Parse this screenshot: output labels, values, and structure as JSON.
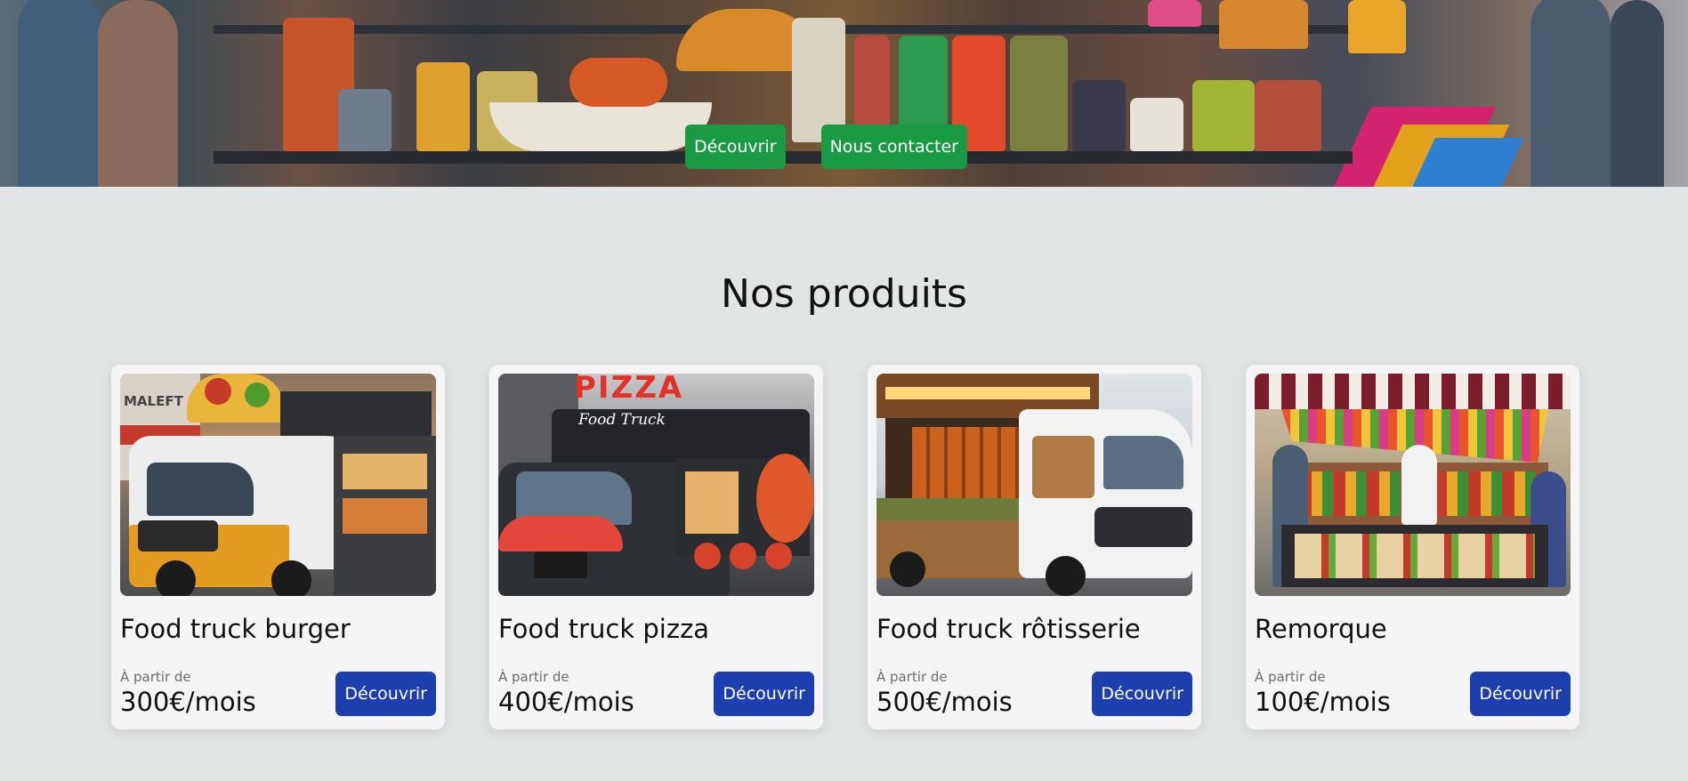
{
  "hero": {
    "buttons": [
      {
        "label": "Découvrir"
      },
      {
        "label": "Nous contacter"
      }
    ]
  },
  "products": {
    "title": "Nos produits",
    "items": [
      {
        "name": "Food truck burger",
        "price_prefix": "À partir de",
        "price": "300€/mois",
        "button": "Découvrir",
        "image": "food-truck-burger-photo",
        "sign_text": "MALEFT"
      },
      {
        "name": "Food truck pizza",
        "price_prefix": "À partir de",
        "price": "400€/mois",
        "button": "Découvrir",
        "image": "food-truck-pizza-photo",
        "sign_text": "PIZZA",
        "sign_subtext": "Food Truck"
      },
      {
        "name": "Food truck rôtisserie",
        "price_prefix": "À partir de",
        "price": "500€/mois",
        "button": "Découvrir",
        "image": "food-truck-rotisserie-photo"
      },
      {
        "name": "Remorque",
        "price_prefix": "À partir de",
        "price": "100€/mois",
        "button": "Découvrir",
        "image": "food-trailer-photo"
      }
    ]
  },
  "colors": {
    "page_bg": "#e2e5e6",
    "hero_button": "#1a9a43",
    "card_button": "#1d3fae",
    "card_bg": "#f5f5f5"
  }
}
